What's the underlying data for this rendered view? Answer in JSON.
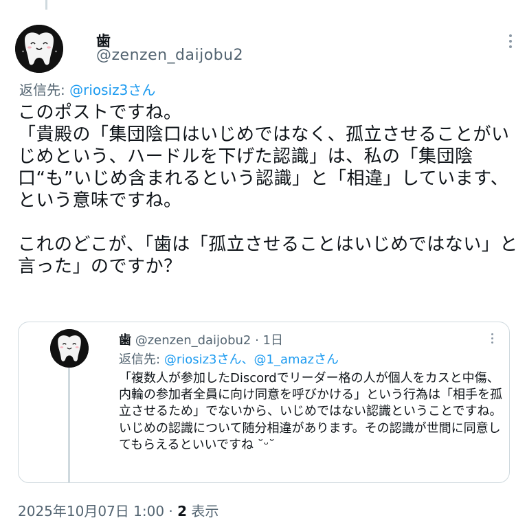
{
  "post": {
    "display_name": "歯",
    "handle": "@zenzen_daijobu2",
    "reply_label": "返信先:",
    "reply_mention": "@riosiz3さん",
    "body": "このポストですね。\n「貴殿の「集団陰口はいじめではなく、孤立させることがいじめという、ハードルを下げた認識」は、私の「集団陰口“も”いじめ含まれるという認識」と「相違」しています、という意味ですね。\n\nこれのどこが、「歯は「孤立させることはいじめではない」と言った」のですか？",
    "timestamp": "2025年10月07日 1:00 ·",
    "views_count": "2",
    "views_label": "表示"
  },
  "quoted": {
    "display_name": "歯",
    "handle": "@zenzen_daijobu2",
    "time": "· 1日",
    "reply_label": "返信先:",
    "reply_mentions": "@riosiz3さん、@1_amazさん",
    "body": "「複数人が参加したDiscordでリーダー格の人が個人をカスと中傷、内輪の参加者全員に向け同意を呼びかける」という行為は「相手を孤立させるため」でないから、いじめではない認識ということですね。いじめの認識について随分相違があります。その認識が世間に同意してもらえるといいですね ˘ᵕ˘"
  },
  "icons": {
    "avatar": "tooth-avatar-icon",
    "more": "more-options-icon"
  },
  "colors": {
    "accent": "#1d9bf0",
    "secondary_text": "#536471",
    "border": "#cfd9de"
  }
}
